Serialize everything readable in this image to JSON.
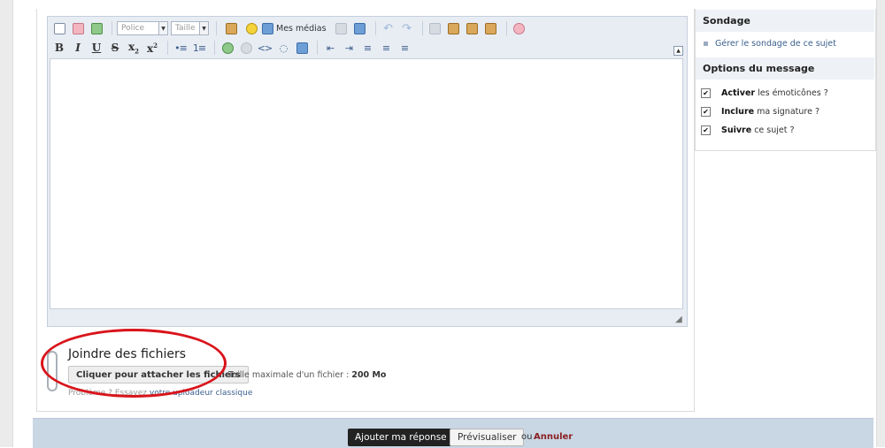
{
  "editor": {
    "font_select": "Police",
    "size_select": "Taille",
    "media_label": "Mes médias"
  },
  "attach": {
    "title": "Joindre des fichiers",
    "button": "Cliquer pour attacher les fichiers",
    "max_size_label": "Taille maximale d'un fichier :",
    "max_size_value": "200 Mo",
    "problem_text": "Problème ? Essayez",
    "classic_link": "votre uploadeur classique"
  },
  "sidebar": {
    "poll_title": "Sondage",
    "poll_link": "Gérer le sondage de ce sujet",
    "options_title": "Options du message",
    "options": [
      {
        "bold": "Activer",
        "rest": "les émoticônes ?",
        "checked": "✔"
      },
      {
        "bold": "Inclure",
        "rest": "ma signature ?",
        "checked": "✔"
      },
      {
        "bold": "Suivre",
        "rest": "ce sujet ?",
        "checked": "✔"
      }
    ]
  },
  "footer": {
    "submit": "Ajouter ma réponse",
    "preview": "Prévisualiser",
    "or": "ou",
    "cancel": "Annuler"
  },
  "colors": {
    "highlight_circle": "#d9141b",
    "footer_bg": "#c9d6e4",
    "link": "#3b5f8d"
  }
}
